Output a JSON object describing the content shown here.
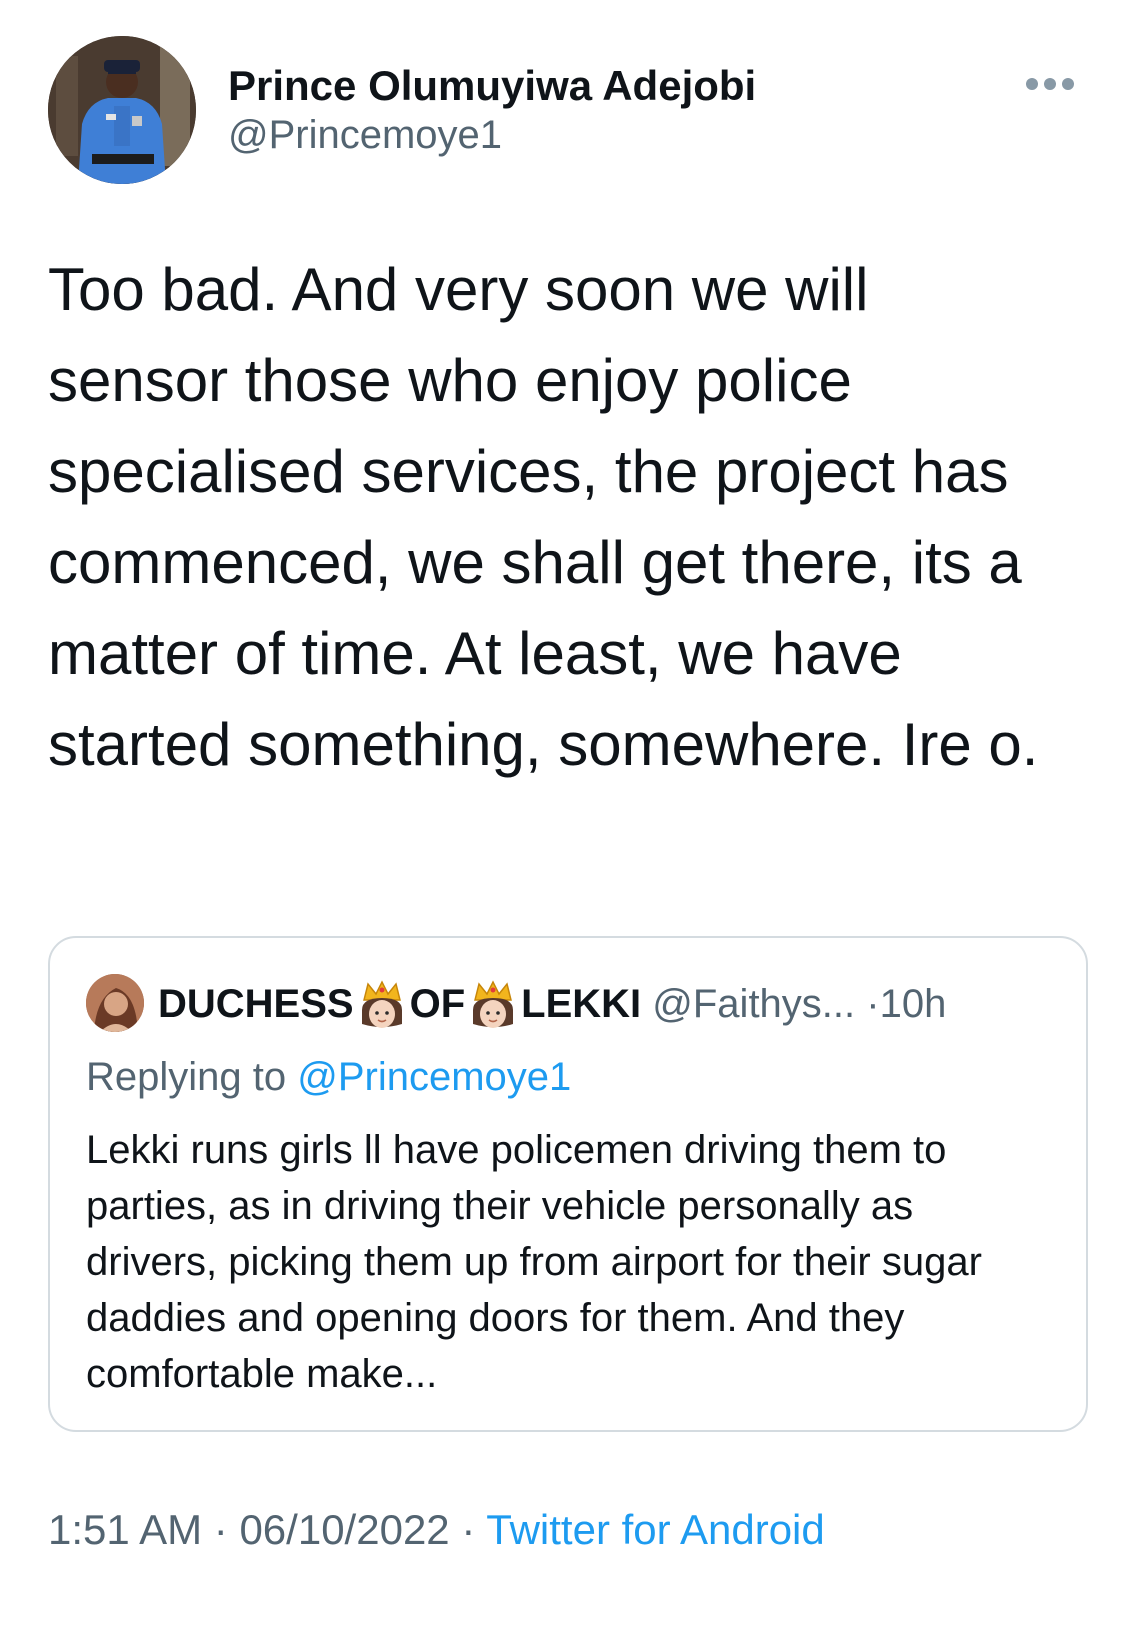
{
  "author": {
    "display_name": "Prince Olumuyiwa Adejobi",
    "handle": "@Princemoye1",
    "avatar_icon": "profile-photo-police-officer"
  },
  "more_icon": "ellipsis-icon",
  "tweet": {
    "text": "Too bad. And very soon we will sensor those who enjoy police specialised services, the project has commenced, we shall get there, its a matter of time. At least, we have started something, somewhere. Ire o."
  },
  "quoted_tweet": {
    "name_part1": "DUCHESS",
    "name_part2": "OF",
    "name_part3": "LEKKI",
    "crown_icon": "princess-emoji",
    "handle": "@Faithys...",
    "separator": "·",
    "time": "10h",
    "replying_prefix": "Replying to",
    "replying_to": "@Princemoye1",
    "text": "Lekki runs girls ll have policemen driving them to parties, as in driving their vehicle personally as drivers, picking them up from airport for their sugar daddies and opening doors for them. And they comfortable make..."
  },
  "footer": {
    "time": "1:51 AM",
    "separator": "·",
    "date": "06/10/2022",
    "source": "Twitter for Android"
  },
  "colors": {
    "text": "#0f1419",
    "secondary": "#536471",
    "link": "#1d9bf0",
    "border": "#d4dbe0"
  }
}
